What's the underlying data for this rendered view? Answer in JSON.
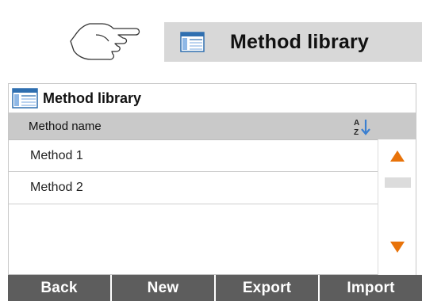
{
  "tile": {
    "title": "Method library",
    "icon": "method-library-icon"
  },
  "window": {
    "title": "Method library",
    "icon": "method-library-icon"
  },
  "table": {
    "column_header": "Method name",
    "sort_icon": "sort-az-icon",
    "rows": [
      {
        "label": "Method 1"
      },
      {
        "label": "Method 2"
      }
    ]
  },
  "scroll": {
    "up_icon": "arrow-up-icon",
    "down_icon": "arrow-down-icon"
  },
  "buttons": {
    "back": "Back",
    "new": "New",
    "export": "Export",
    "import": "Import"
  },
  "colors": {
    "accent_arrow": "#e8730a",
    "sort_arrow": "#3a7fd0",
    "button_bg": "#5d5d5d",
    "header_bg": "#c9c9c9",
    "tile_bg": "#d8d8d8"
  }
}
